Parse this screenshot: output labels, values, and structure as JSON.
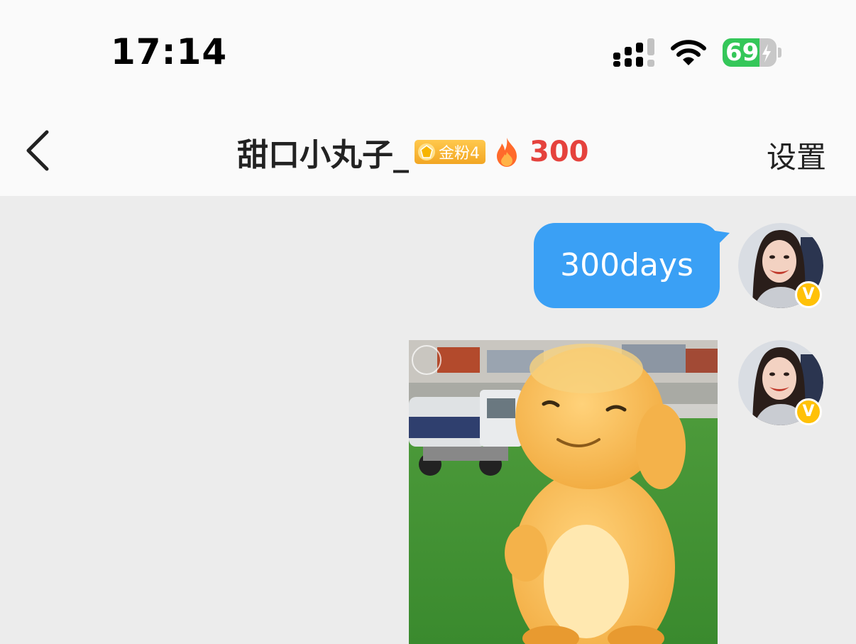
{
  "status_bar": {
    "time": "17:14",
    "battery_percent": 69,
    "battery_label": "69",
    "signal_icon": "cellular-signal-icon",
    "wifi_icon": "wifi-icon",
    "battery_icon": "battery-charging-icon"
  },
  "header": {
    "back_icon": "chevron-left-icon",
    "title": "甜口小丸子_",
    "fan_badge": "金粉4",
    "fan_badge_icon": "gem-icon",
    "streak_icon": "fire-icon",
    "streak_count": "300",
    "settings_label": "设置"
  },
  "messages": [
    {
      "type": "text",
      "sender": "self",
      "text": "300days"
    },
    {
      "type": "image",
      "sender": "self",
      "image_desc_icon": "sticker-image"
    }
  ],
  "avatar": {
    "verified_badge": "V"
  },
  "colors": {
    "bubble": "#3aa0f5",
    "streak": "#e5423d",
    "badge": "#f2a623",
    "battery": "#34c759",
    "chat_bg": "#ececec"
  }
}
